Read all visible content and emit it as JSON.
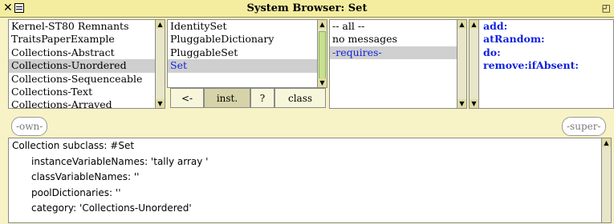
{
  "window": {
    "title": "System Browser: Set",
    "close_glyph": "✕",
    "collapse_glyph": "◰"
  },
  "categories": {
    "items": [
      {
        "label": "Kernel-ST80 Remnants",
        "selected": false
      },
      {
        "label": "TraitsPaperExample",
        "selected": false
      },
      {
        "label": "Collections-Abstract",
        "selected": false
      },
      {
        "label": "Collections-Unordered",
        "selected": true
      },
      {
        "label": "Collections-Sequenceable",
        "selected": false
      },
      {
        "label": "Collections-Text",
        "selected": false
      },
      {
        "label": "Collections-Arrayed",
        "selected": false
      }
    ]
  },
  "classes": {
    "items": [
      {
        "label": "IdentitySet",
        "selected": false
      },
      {
        "label": "PluggableDictionary",
        "selected": false
      },
      {
        "label": "PluggableSet",
        "selected": false
      },
      {
        "label": "Set",
        "selected": true
      }
    ]
  },
  "protocols": {
    "items": [
      {
        "label": "-- all --",
        "selected": false
      },
      {
        "label": "no messages",
        "selected": false
      },
      {
        "label": "-requires-",
        "selected": true
      }
    ]
  },
  "methods": {
    "items": [
      {
        "label": "add:"
      },
      {
        "label": "atRandom:"
      },
      {
        "label": "do:"
      },
      {
        "label": "remove:ifAbsent:"
      }
    ]
  },
  "buttons": {
    "back": "<-",
    "instance": "inst.",
    "help": "?",
    "class": "class"
  },
  "traits": {
    "own": "-own-",
    "super": "-super-"
  },
  "code": {
    "lines": [
      "Collection subclass: #Set",
      "instanceVariableNames: 'tally array '",
      "classVariableNames: ''",
      "poolDictionaries: ''",
      "category: 'Collections-Unordered'"
    ]
  }
}
